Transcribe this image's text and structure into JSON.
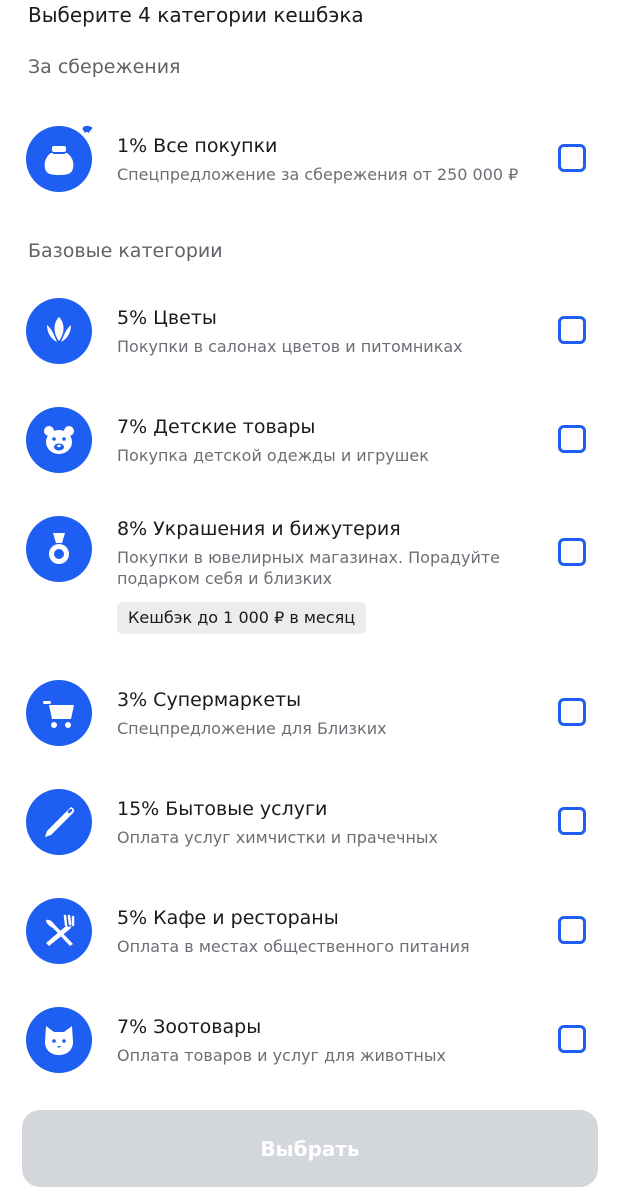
{
  "page_title": "Выберите 4 категории кешбэка",
  "sections": {
    "savings": "За сбережения",
    "base": "Базовые категории"
  },
  "items": [
    {
      "title": "1% Все покупки",
      "subtitle": "Спецпредложение за сбережения от 250 000 ₽",
      "icon": "money-bag-icon",
      "checked": false
    },
    {
      "title": "5% Цветы",
      "subtitle": "Покупки в салонах цветов и питомниках",
      "icon": "flower-icon",
      "checked": false
    },
    {
      "title": "7% Детские товары",
      "subtitle": "Покупка детской одежды и игрушек",
      "icon": "teddy-bear-icon",
      "checked": false
    },
    {
      "title": "8% Украшения и бижутерия",
      "subtitle": "Покупки в ювелирных магазинах. Порадуйте подарком себя и близких",
      "badge": "Кешбэк до 1 000 ₽ в месяц",
      "icon": "medal-icon",
      "checked": false
    },
    {
      "title": "3% Супермаркеты",
      "subtitle": "Спецпредложение для Близких",
      "icon": "shopping-cart-icon",
      "checked": false
    },
    {
      "title": "15% Бытовые услуги",
      "subtitle": "Оплата услуг химчистки и прачечных",
      "icon": "needle-icon",
      "checked": false
    },
    {
      "title": "5% Кафе и рестораны",
      "subtitle": "Оплата в местах общественного питания",
      "icon": "cutlery-icon",
      "checked": false
    },
    {
      "title": "7% Зоотовары",
      "subtitle": "Оплата товаров и услуг для животных",
      "icon": "cat-icon",
      "checked": false
    }
  ],
  "select_button": "Выбрать",
  "colors": {
    "accent": "#1e5ef3",
    "button_disabled": "#d3d6da",
    "muted_text": "#6b6f75",
    "badge_bg": "#ececec"
  }
}
